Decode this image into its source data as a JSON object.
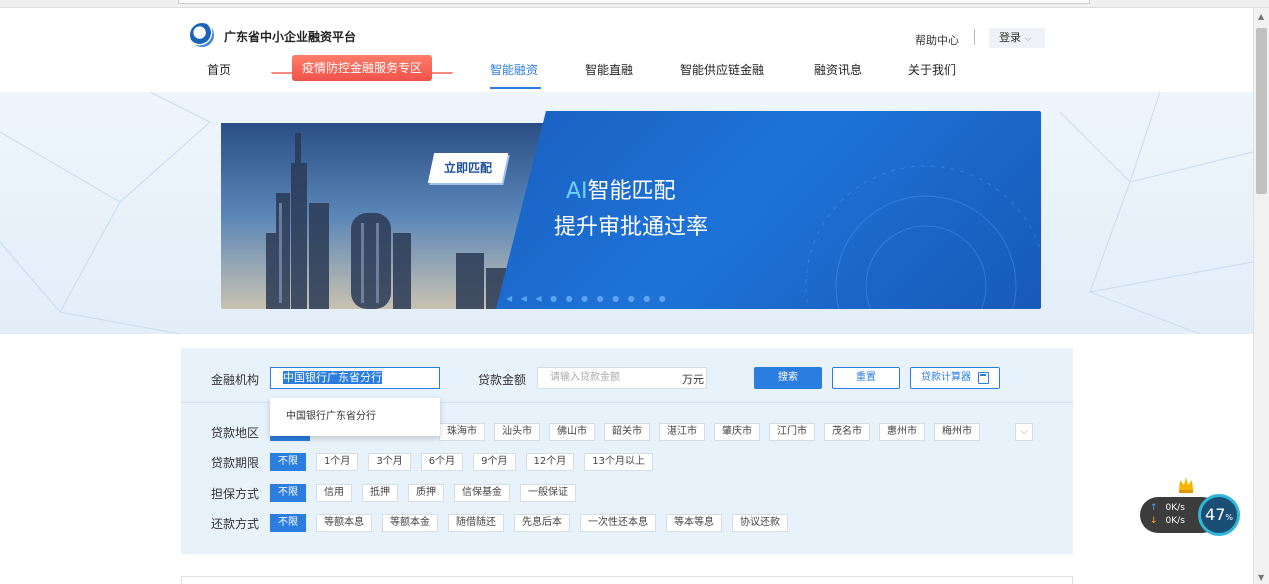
{
  "site": {
    "name": "广东省中小企业融资平台"
  },
  "header": {
    "help": "帮助中心",
    "login": "登录",
    "login_caret": "⌵"
  },
  "nav": {
    "home": "首页",
    "covid": "疫情防控金融服务专区",
    "smart_financing": "智能融资",
    "smart_direct": "智能直融",
    "supply_chain": "智能供应链金融",
    "news": "融资讯息",
    "about": "关于我们"
  },
  "banner": {
    "cta": "立即匹配",
    "title_ai": "AI",
    "title_rest": "智能匹配",
    "subtitle": "提升审批通过率",
    "dots": "◀ ◀ ◀ ● ● ● ● ● ● ● ●"
  },
  "filters": {
    "institution_label": "金融机构",
    "institution_value": "中国银行广东省分行",
    "amount_label": "贷款金额",
    "amount_placeholder": "请输入贷款金额",
    "amount_unit": "万元",
    "search": "搜索",
    "reset": "重置",
    "calculator": "贷款计算器",
    "dropdown_option": "中国银行广东省分行",
    "region_label": "贷款地区",
    "region_options": [
      "珠海市",
      "汕头市",
      "佛山市",
      "韶关市",
      "湛江市",
      "肇庆市",
      "江门市",
      "茂名市",
      "惠州市",
      "梅州市"
    ],
    "expand": "⌵",
    "term_label": "贷款期限",
    "term_options": [
      "不限",
      "1个月",
      "3个月",
      "6个月",
      "9个月",
      "12个月",
      "13个月以上"
    ],
    "guarantee_label": "担保方式",
    "guarantee_options": [
      "不限",
      "信用",
      "抵押",
      "质押",
      "信保基金",
      "一般保证"
    ],
    "repay_label": "还款方式",
    "repay_options": [
      "不限",
      "等额本息",
      "等额本金",
      "随借随还",
      "先息后本",
      "一次性还本息",
      "等本等息",
      "协议还款"
    ]
  },
  "speed_widget": {
    "up": "0K/s",
    "down": "0K/s",
    "up_arrow": "↑",
    "down_arrow": "↓",
    "percent": "47",
    "percent_sign": "%"
  },
  "scrollbar": {
    "up": "▲",
    "down": "▼"
  }
}
